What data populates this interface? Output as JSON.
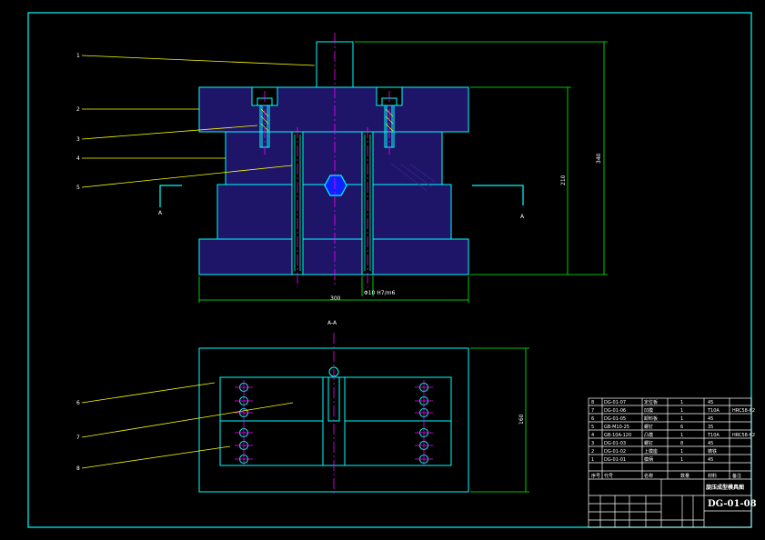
{
  "drawing": {
    "number": "DG-01-08",
    "title": "旋压成型模具图",
    "section_label": "A-A",
    "section_marks": [
      "A",
      "A"
    ]
  },
  "dimensions": {
    "overall_height": "340",
    "height_inner": "210",
    "width": "300",
    "bushing_note": "Φ10 H7/m6",
    "plan_height": "160"
  },
  "callouts": [
    "1",
    "2",
    "3",
    "4",
    "5",
    "6",
    "7",
    "8"
  ],
  "bom": {
    "headers": [
      "序号",
      "代号",
      "名称",
      "数量",
      "材料",
      "备注"
    ],
    "rows": [
      {
        "no": "8",
        "code": "DG-01-07",
        "name": "定位板",
        "qty": "1",
        "mat": "45",
        "note": ""
      },
      {
        "no": "7",
        "code": "DG-01-06",
        "name": "凹模",
        "qty": "1",
        "mat": "T10A",
        "note": "HRC58-62"
      },
      {
        "no": "6",
        "code": "DG-01-05",
        "name": "卸料板",
        "qty": "1",
        "mat": "45",
        "note": ""
      },
      {
        "no": "5",
        "code": "GB-M10-25",
        "name": "螺钉",
        "qty": "6",
        "mat": "35",
        "note": ""
      },
      {
        "no": "4",
        "code": "GB-10A-120",
        "name": "凸模",
        "qty": "1",
        "mat": "T10A",
        "note": "HRC58-62"
      },
      {
        "no": "3",
        "code": "DG-01-03",
        "name": "螺钉",
        "qty": "8",
        "mat": "45",
        "note": ""
      },
      {
        "no": "2",
        "code": "DG-01-02",
        "name": "上模座",
        "qty": "1",
        "mat": "铸铁",
        "note": ""
      },
      {
        "no": "1",
        "code": "DG-01-01",
        "name": "模柄",
        "qty": "1",
        "mat": "45",
        "note": ""
      }
    ]
  },
  "colors": {
    "border": "#00ffff",
    "fill": "#1e1468",
    "centerline": "#ff00ff",
    "leader": "#ffff00",
    "dimension": "#00ff00",
    "background": "#000000"
  }
}
